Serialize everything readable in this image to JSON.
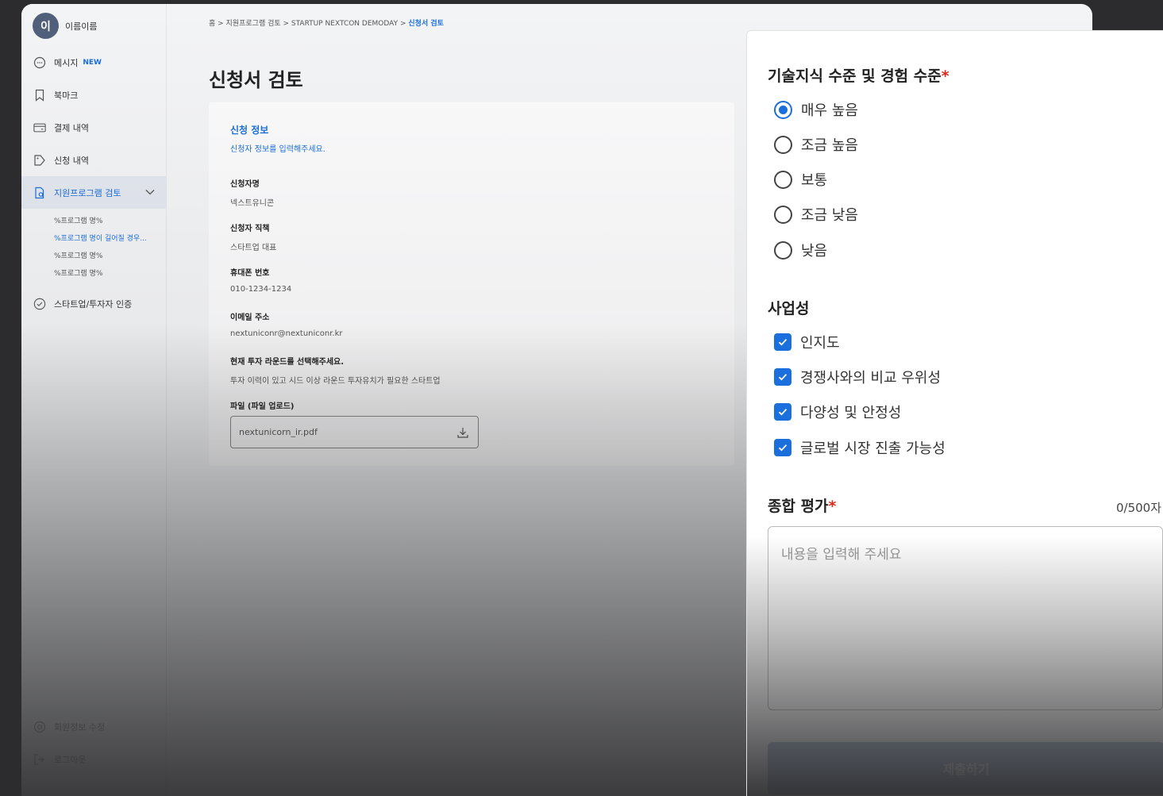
{
  "user": {
    "avatar_initial": "이",
    "name": "이름이름"
  },
  "sidebar": {
    "items": [
      {
        "label": "메시지",
        "badge": "NEW",
        "icon": "message-icon"
      },
      {
        "label": "북마크",
        "icon": "bookmark-icon"
      },
      {
        "label": "결제 내역",
        "icon": "card-icon"
      },
      {
        "label": "신청 내역",
        "icon": "tag-icon"
      },
      {
        "label": "지원프로그램 검토",
        "icon": "document-search-icon"
      },
      {
        "label": "스타트업/투자자 인증",
        "icon": "check-circle-icon"
      }
    ],
    "sub_items": [
      "%프로그램 명%",
      "%프로그램 명이 길어질 경우...",
      "%프로그램 명%",
      "%프로그램 명%"
    ],
    "bottom": [
      {
        "label": "회원정보 수정",
        "icon": "gear-icon"
      },
      {
        "label": "로그아웃",
        "icon": "logout-icon"
      }
    ]
  },
  "breadcrumb": {
    "path": "홈 > 지원프로그램 검토 > STARTUP NEXTCON DEMODAY >",
    "current": "신청서 검토"
  },
  "page_title": "신청서 검토",
  "application": {
    "title": "신청 정보",
    "subtitle": "신청자 정보를 입력해주세요.",
    "fields": [
      {
        "label": "신청자명",
        "value": "넥스트유니콘"
      },
      {
        "label": "신청자 직책",
        "value": "스타트업 대표"
      },
      {
        "label": "휴대폰 번호",
        "value": "010-1234-1234"
      },
      {
        "label": "이메일 주소",
        "value": "nextuniconr@nextuniconr.kr"
      },
      {
        "label": "현재 투자 라운드를 선택해주세요.",
        "value": "투자 이력이 있고 시드 이상 라운드 투자유치가 필요한 스타트업"
      },
      {
        "label": "파일 (파일 업로드)",
        "value": ""
      }
    ],
    "file_name": "nextunicorn_ir.pdf"
  },
  "review": {
    "tech_title": "기술지식 수준 및 경험 수준",
    "tech_required": "*",
    "tech_options": [
      "매우 높음",
      "조금 높음",
      "보통",
      "조금 낮음",
      "낮음"
    ],
    "tech_selected": "매우 높음",
    "biz_title": "사업성",
    "biz_options": [
      "인지도",
      "경쟁사와의 비교 우위성",
      "다양성 및 안정성",
      "글로벌 시장 진출 가능성"
    ],
    "overall_title": "종합 평가",
    "overall_required": "*",
    "counter": "0/500자",
    "placeholder": "내용을 입력해 주세요",
    "submit_label": "제출하기"
  },
  "colors": {
    "accent": "#1a6fdc",
    "required": "#e0281b"
  }
}
